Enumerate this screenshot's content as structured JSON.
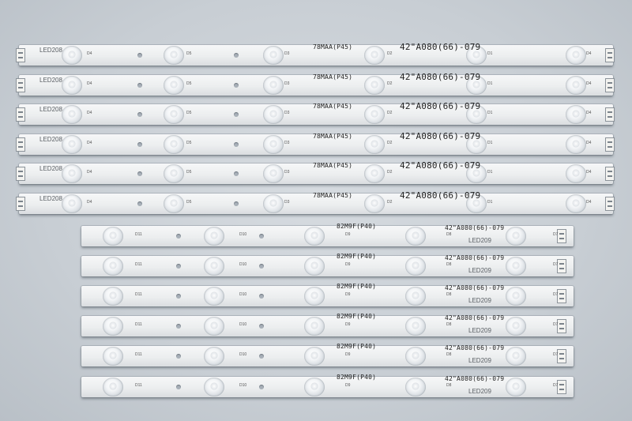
{
  "scene": {
    "description_labels": {
      "upper_part_label": "LED208",
      "upper_model": "42\"A080(66)-079",
      "upper_code": "78MAA(P45)",
      "lower_part_label": "LED209",
      "lower_model": "42\"A080(66)-079",
      "lower_code": "82M9F(P40)"
    },
    "upper_led_labels": [
      "D4",
      "D5",
      "D3",
      "D2",
      "D1"
    ],
    "lower_led_labels": [
      "D11",
      "D10",
      "D9",
      "D8",
      "D7"
    ]
  }
}
